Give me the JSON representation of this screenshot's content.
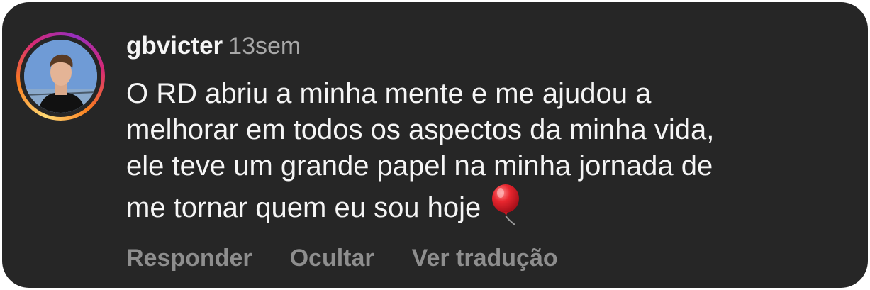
{
  "comment": {
    "username": "gbvicter",
    "time": "13sem",
    "text_lines": [
      "O RD abriu a minha mente e me ajudou a",
      "melhorar em todos os aspectos da minha vida,",
      "ele teve um grande papel na minha jornada de",
      "me tornar quem eu sou hoje"
    ],
    "emoji": "balloon-icon"
  },
  "actions": {
    "reply_label": "Responder",
    "hide_label": "Ocultar",
    "translate_label": "Ver tradução"
  },
  "colors": {
    "card_background": "#262626",
    "primary_text": "#f5f5f5",
    "secondary_text": "#a8a8a8",
    "action_text": "#8e8e8e"
  }
}
